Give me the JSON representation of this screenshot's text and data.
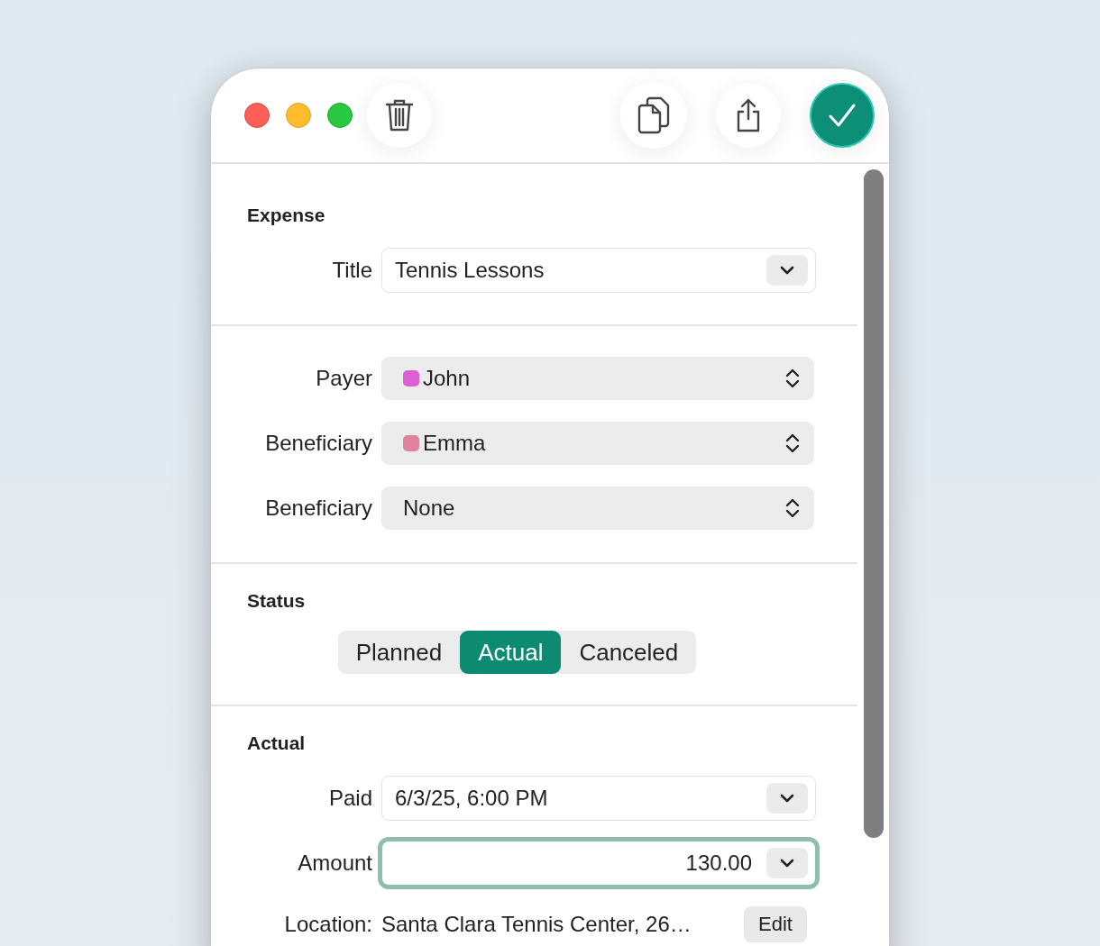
{
  "sections": [
    {
      "heading": "Expense",
      "rows": [
        {
          "kind": "combo",
          "label": "Title",
          "value": "Tennis Lessons",
          "focused": false
        }
      ]
    },
    {
      "rows": [
        {
          "kind": "popup",
          "label": "Payer",
          "value": "John",
          "color": "#dd5fd6"
        },
        {
          "kind": "popup",
          "label": "Beneficiary",
          "value": "Emma",
          "color": "#e2819f"
        },
        {
          "kind": "popup",
          "label": "Beneficiary",
          "value": "None"
        }
      ]
    },
    {
      "heading": "Status",
      "rows": [
        {
          "kind": "segments",
          "segments": [
            {
              "label": "Planned",
              "selected": false
            },
            {
              "label": "Actual",
              "selected": true
            },
            {
              "label": "Canceled",
              "selected": false
            }
          ]
        }
      ]
    },
    {
      "heading": "Actual",
      "rows": [
        {
          "kind": "combo",
          "label": "Paid",
          "value": "6/3/25, 6:00 PM",
          "focused": false
        },
        {
          "kind": "amount",
          "label": "Amount",
          "value": "130.00",
          "focused": true
        },
        {
          "kind": "location",
          "label": "Location:",
          "value": "Santa Clara Tennis Center, 26…",
          "button": "Edit"
        }
      ]
    }
  ]
}
